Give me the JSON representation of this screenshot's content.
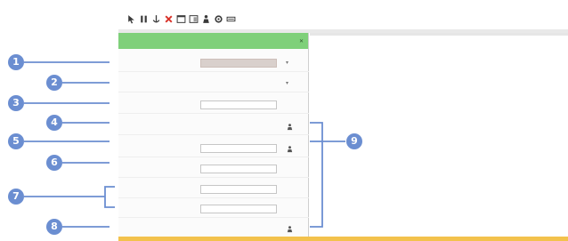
{
  "window": {
    "title": ""
  },
  "toolbar": {
    "buttons": [
      {
        "icon": "cursor-icon"
      },
      {
        "icon": "pause-icon"
      },
      {
        "icon": "anchor-icon"
      },
      {
        "icon": "close-x-icon",
        "color": "#d9342b"
      },
      {
        "icon": "window-icon"
      },
      {
        "icon": "window-icon"
      },
      {
        "icon": "figure-icon"
      },
      {
        "icon": "settings-icon"
      },
      {
        "icon": "edit-icon"
      }
    ]
  },
  "panel": {
    "header_color": "#7fd07a",
    "title": "",
    "rows": [
      {
        "label": "",
        "value": "",
        "control": "gray-dropdown"
      },
      {
        "label": "",
        "value": "",
        "control": "dropdown"
      },
      {
        "label": "",
        "value": "",
        "control": "spin"
      },
      {
        "label": "",
        "value": "",
        "control": "field-button"
      },
      {
        "label": "",
        "value": "",
        "control": "spin-button"
      },
      {
        "label": "",
        "value": "",
        "control": "spin"
      },
      {
        "label": "",
        "value": "",
        "control": "spin"
      },
      {
        "label": "",
        "value": "",
        "control": "spin"
      },
      {
        "label": "",
        "value": "",
        "control": "field-button"
      }
    ]
  },
  "callouts": {
    "color": "#6b8ed1",
    "numbers": [
      "1",
      "2",
      "3",
      "4",
      "5",
      "6",
      "7",
      "8",
      "9"
    ]
  },
  "statusbar": {
    "color": "#f3c24c"
  }
}
